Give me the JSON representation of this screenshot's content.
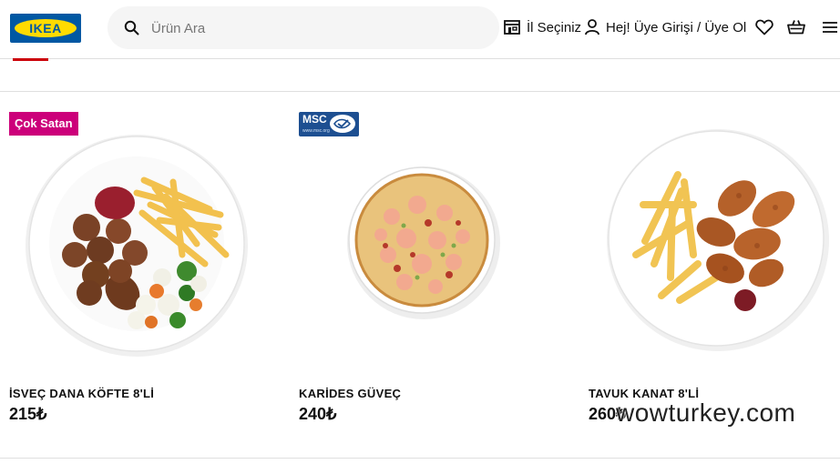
{
  "header": {
    "logo_text": "IKEA",
    "search_placeholder": "Ürün Ara",
    "store_label": "İl Seçiniz",
    "user_label": "Hej! Üye Girişi / Üye Ol",
    "icons": [
      "search-icon",
      "store-icon",
      "user-icon",
      "heart-icon",
      "basket-icon",
      "menu-icon"
    ]
  },
  "products": [
    {
      "badge": "Çok Satan",
      "name": "İSVEÇ DANA KÖFTE 8'Lİ",
      "price": "215₺"
    },
    {
      "logo": {
        "text": "MSC",
        "url": "www.msc.org"
      },
      "name": "KARİDES GÜVEÇ",
      "price": "240₺"
    },
    {
      "name": "TAVUK KANAT 8'Lİ",
      "price": "260₺"
    }
  ],
  "watermark": "wowturkey.com",
  "colors": {
    "brand_blue": "#0058a3",
    "brand_yellow": "#ffdb00",
    "badge_magenta": "#cc007a",
    "active_tab_red": "#cc0008",
    "msc_blue": "#1d4f91"
  }
}
